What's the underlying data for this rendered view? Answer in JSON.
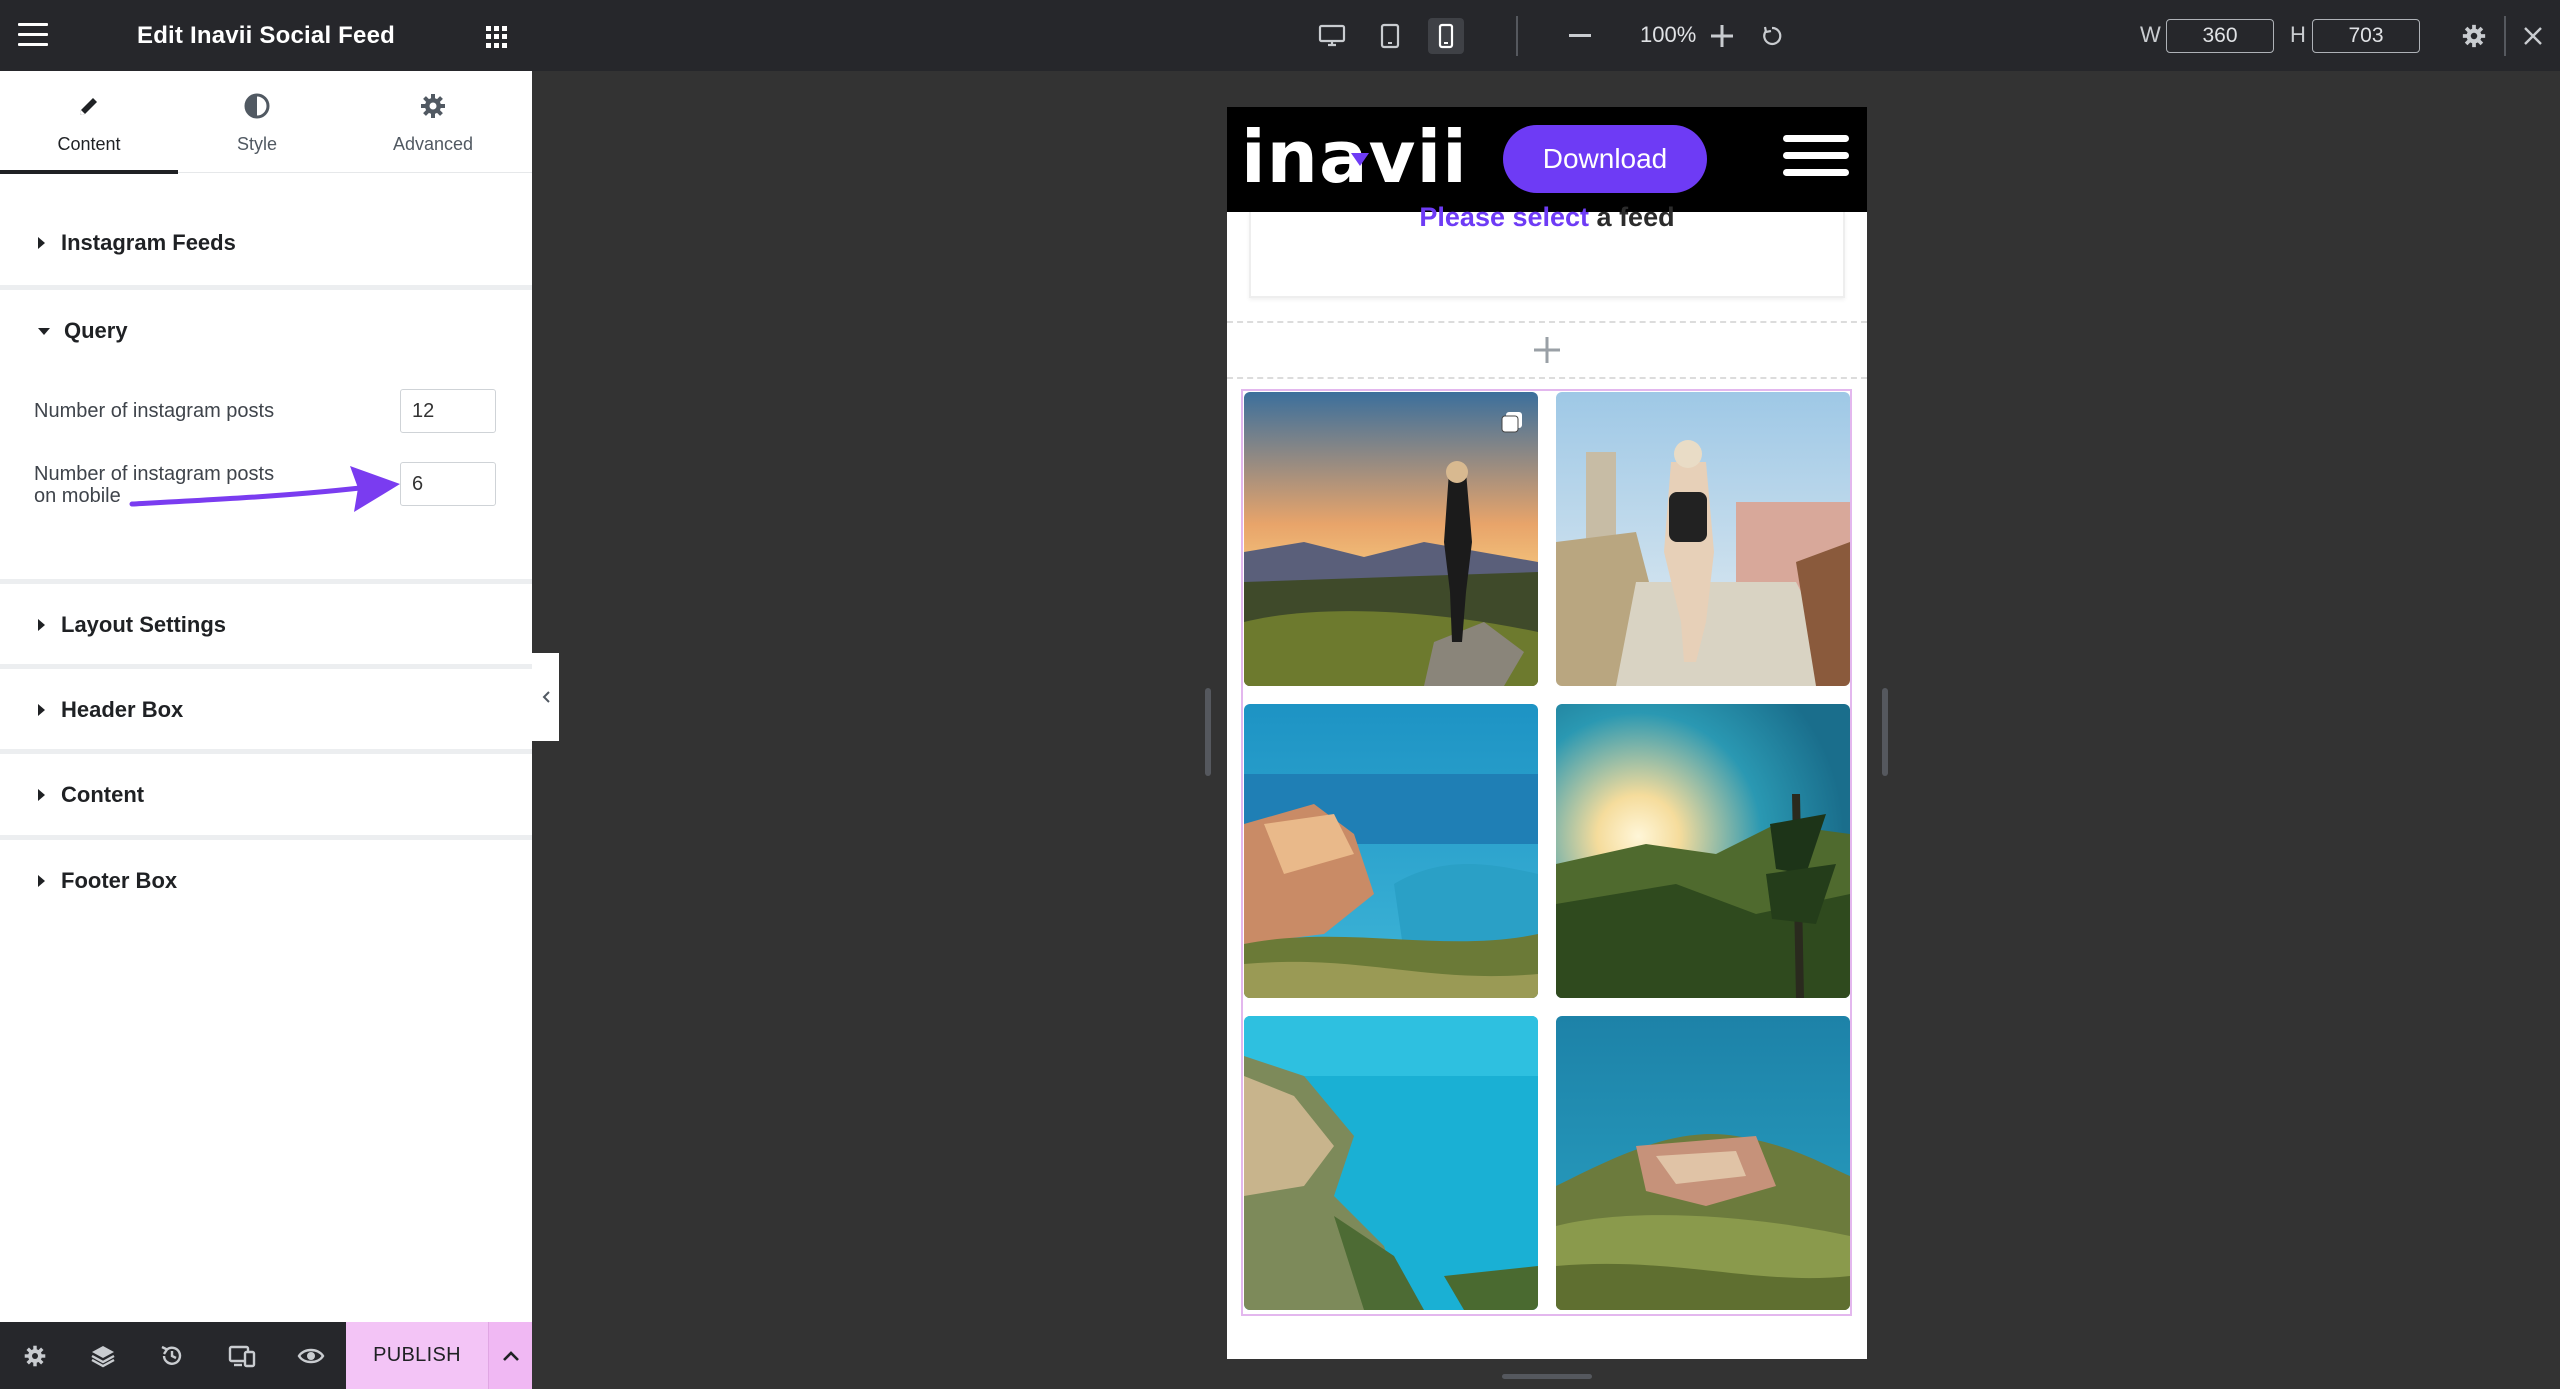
{
  "panel": {
    "title": "Edit Inavii Social Feed",
    "tabs": [
      {
        "label": "Content",
        "icon": "pencil-icon",
        "active": true
      },
      {
        "label": "Style",
        "icon": "half-circle-icon",
        "active": false
      },
      {
        "label": "Advanced",
        "icon": "gear-icon",
        "active": false
      }
    ],
    "sections": {
      "instagram_feeds": "Instagram Feeds",
      "query": "Query",
      "layout_settings": "Layout Settings",
      "header_box": "Header Box",
      "content": "Content",
      "footer_box": "Footer Box"
    },
    "query": {
      "posts_label": "Number of instagram posts",
      "posts_value": "12",
      "mobile_label_line1": "Number of instagram posts",
      "mobile_label_line2": "on mobile",
      "mobile_value": "6"
    },
    "footer": {
      "publish_label": "PUBLISH",
      "icons": [
        "settings-icon",
        "layers-icon",
        "history-icon",
        "responsive-icon",
        "eye-icon"
      ]
    }
  },
  "toolbar": {
    "devices": [
      "desktop-icon",
      "tablet-icon",
      "mobile-icon"
    ],
    "active_device": "mobile",
    "zoom": "100%",
    "width_label": "W",
    "width_value": "360",
    "height_label": "H",
    "height_value": "703"
  },
  "preview": {
    "logo": "inavii",
    "download_label": "Download",
    "feed_message_highlight": "Please select",
    "feed_message_rest": " a feed",
    "photos": [
      "woman-on-hillside-sunset",
      "woman-walking-village-path",
      "coastal-village-harbor",
      "mountain-sunset-trees",
      "turquoise-sea-cliffs",
      "hilltop-village-sea"
    ]
  },
  "colors": {
    "accent": "#6e3bf5",
    "publish": "#f3c4f6",
    "dark": "#26272b",
    "canvas": "#333333"
  }
}
